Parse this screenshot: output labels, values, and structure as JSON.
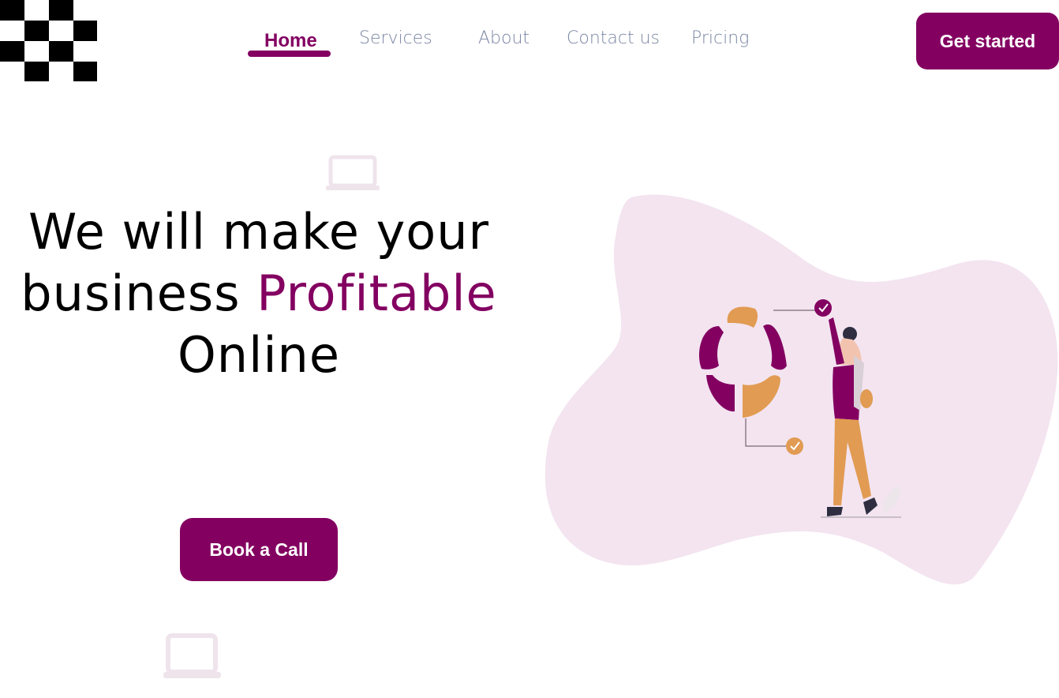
{
  "brand": {
    "logo_icon": "checkerboard-logo-icon"
  },
  "nav": {
    "items": [
      {
        "label": "Home",
        "active": true
      },
      {
        "label": "Services",
        "active": false
      },
      {
        "label": "About",
        "active": false
      },
      {
        "label": "Contact us",
        "active": false
      },
      {
        "label": "Pricing",
        "active": false
      }
    ],
    "cta_label": "Get started"
  },
  "hero": {
    "line1": "We will make your",
    "line2_prefix": "business",
    "line2_accent": "Profitable",
    "line3": "Online",
    "button_label": "Book a Call"
  },
  "decor": {
    "icons": [
      "laptop-icon",
      "laptop-icon"
    ],
    "illustration": "person-with-chart-illustration"
  },
  "colors": {
    "accent": "#830061",
    "blob": "#f3e4f0",
    "orange": "#e19b52",
    "nav_text": "#7a86a3"
  }
}
